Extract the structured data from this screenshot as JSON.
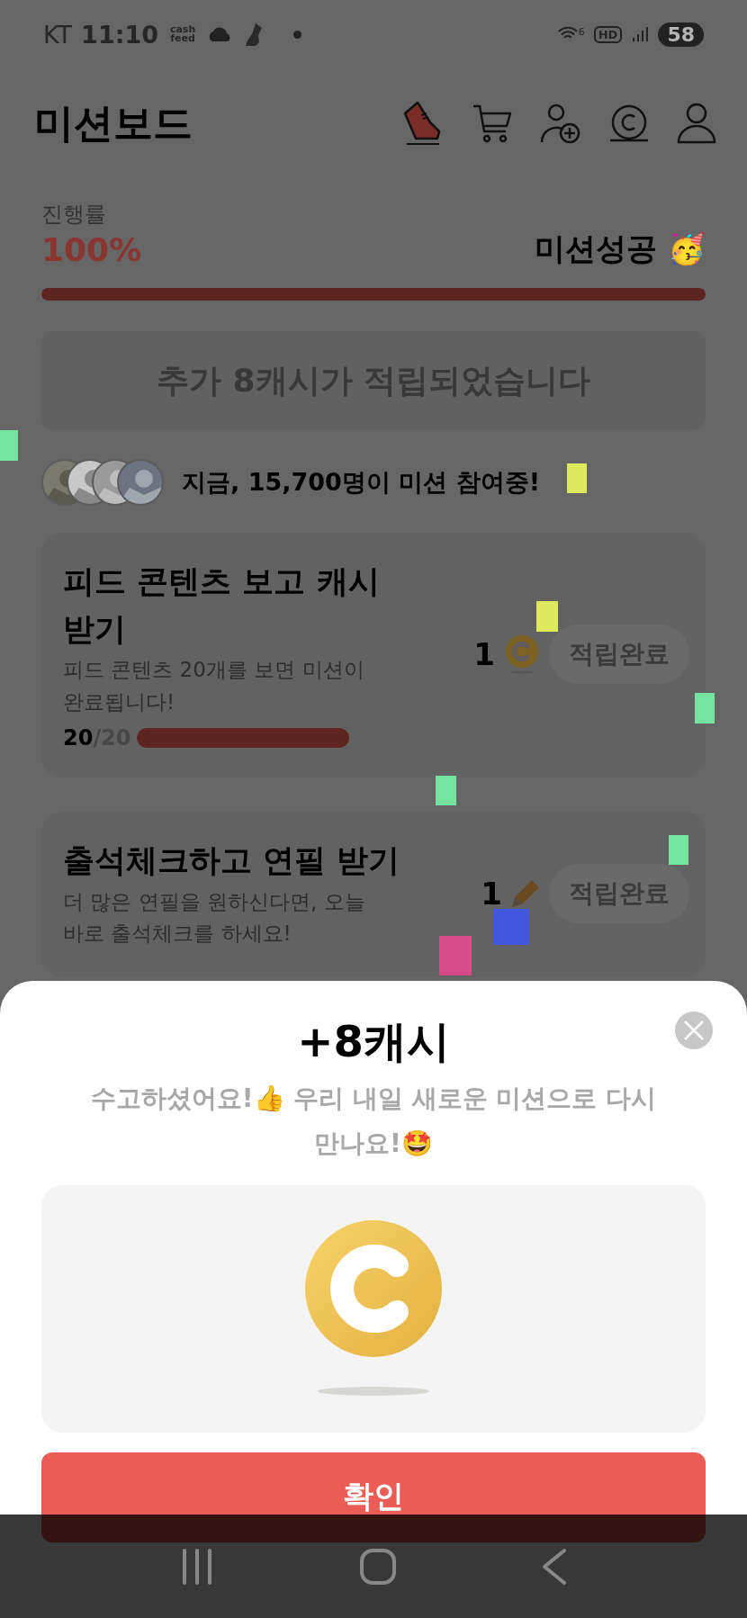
{
  "status_bar": {
    "carrier": "KT",
    "time": "11:10",
    "app_badge": "cash feed",
    "wifi_band": "6",
    "hd": "HD",
    "battery": "58"
  },
  "header": {
    "title": "미션보드"
  },
  "progress": {
    "label": "진행률",
    "percent": "100%",
    "status": "미션성공 🥳",
    "level": 1
  },
  "banner": {
    "text": "추가 8캐시가 적립되었습니다"
  },
  "participants": {
    "text": "지금, **15,700명**이 미션 참여중!"
  },
  "missions": [
    {
      "title": "피드 콘텐츠 보고 캐시 받기",
      "description": "피드 콘텐츠 20개를 보면 미션이 완료됩니다!",
      "progress_current": "20",
      "progress_total": "/20",
      "level": 1,
      "reward": "1",
      "kind": "coin",
      "button": "적립완료",
      "completed": true
    },
    {
      "title": "출석체크하고 연필 받기",
      "description": "더 많은 연필을 원하신다면, 오늘 바로 출석체크를 하세요!",
      "reward": "1",
      "kind": "pencil",
      "button": "적립완료",
      "completed": true
    }
  ],
  "sheet": {
    "title": "+8캐시",
    "message": "수고하셨어요!👍 우리 내일 새로운 미션으로 다시 만나요!🤩",
    "confirm": "확인"
  }
}
